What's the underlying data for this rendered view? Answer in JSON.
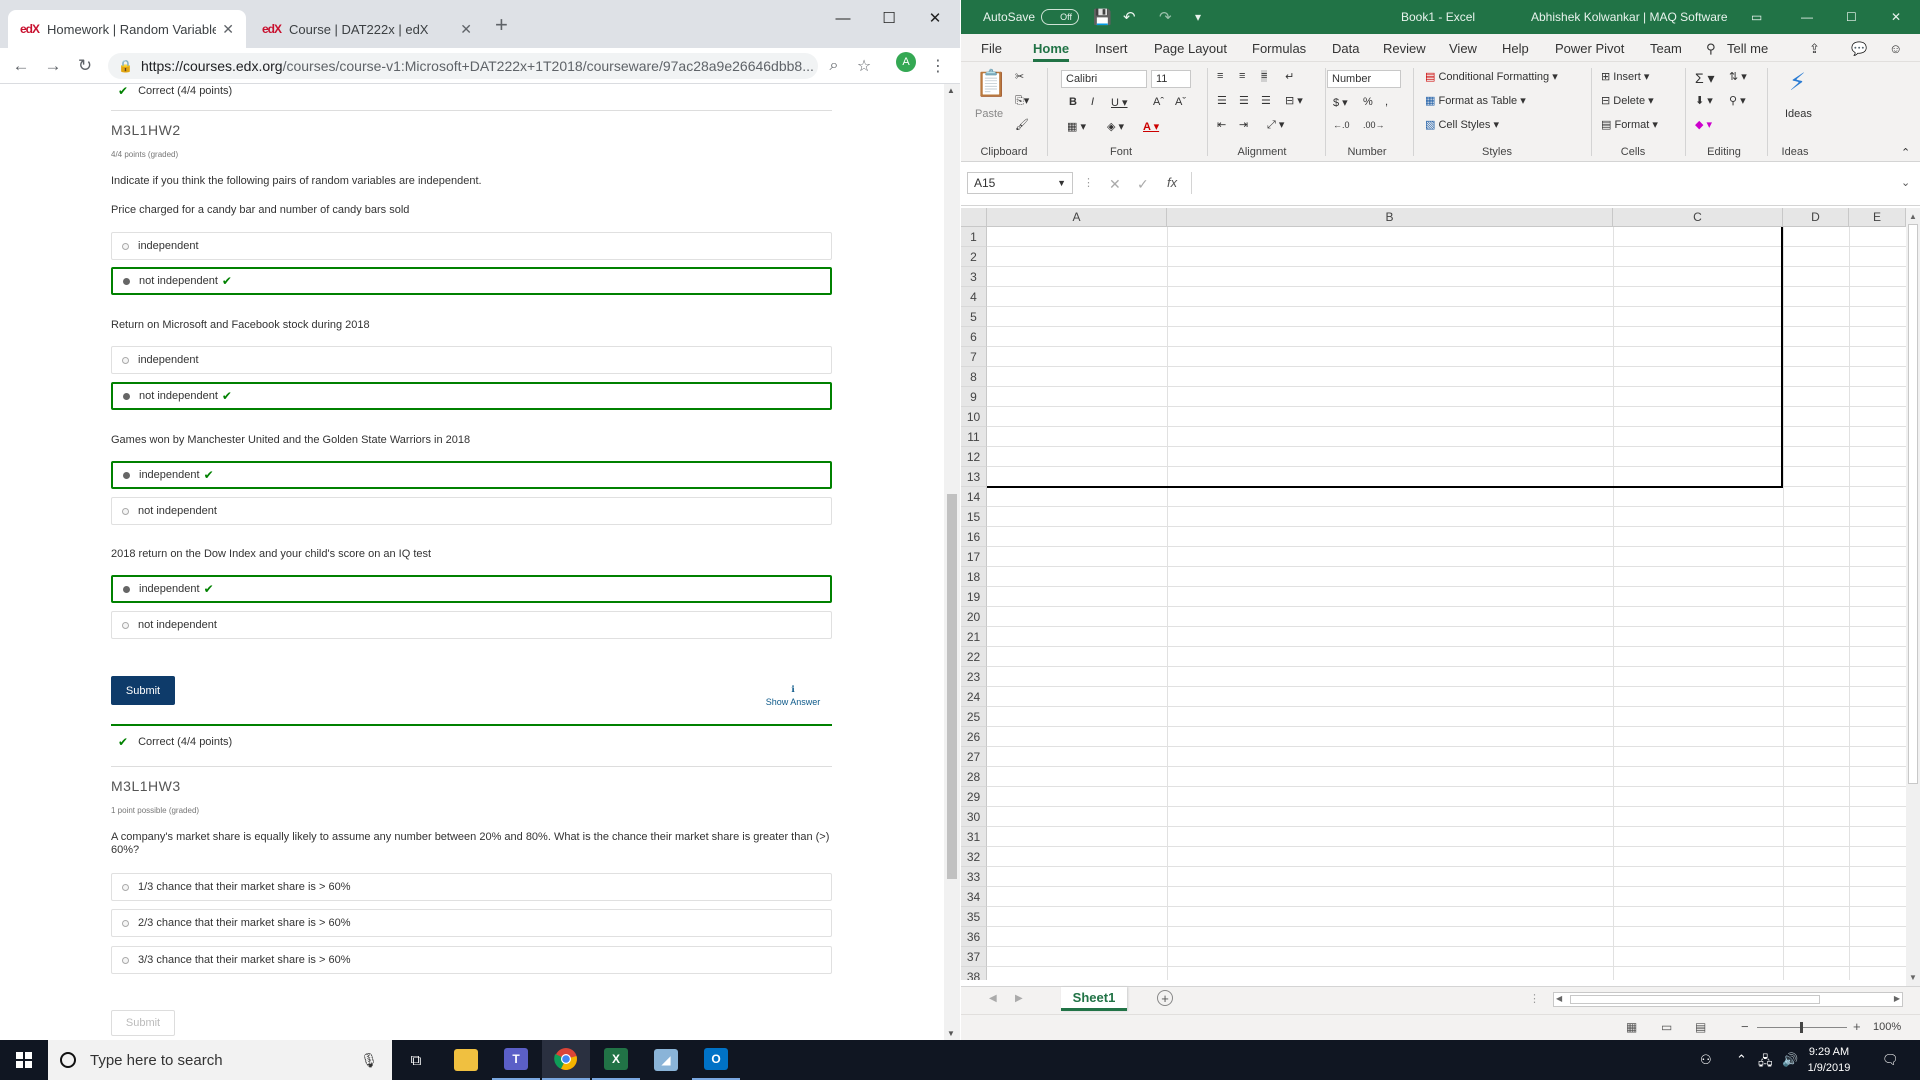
{
  "chrome": {
    "tabs": [
      {
        "favicon": "edX",
        "title": "Homework | Random Variable De"
      },
      {
        "favicon": "edX",
        "title": "Course | DAT222x | edX"
      }
    ],
    "new_tab": "+",
    "url_host": "https://courses.edx.org",
    "url_path": "/courses/course-v1:Microsoft+DAT222x+1T2018/courseware/97ac28a9e26646dbb8...",
    "avatar_letter": "A"
  },
  "edx": {
    "prev_correct": "Correct (4/4 points)",
    "hw2": {
      "title": "M3L1HW2",
      "subtitle": "4/4 points (graded)",
      "prompt": "Indicate if you think the following pairs of random variables are independent.",
      "questions": [
        {
          "text": "Price charged for a candy bar and number of candy bars sold",
          "options": [
            {
              "label": "independent"
            },
            {
              "label": "not independent"
            }
          ]
        },
        {
          "text": "Return on Microsoft and Facebook stock during 2018",
          "options": [
            {
              "label": "independent"
            },
            {
              "label": "not independent"
            }
          ]
        },
        {
          "text": "Games won by Manchester United and the Golden State Warriors in 2018",
          "options": [
            {
              "label": "independent"
            },
            {
              "label": "not independent"
            }
          ]
        },
        {
          "text": "2018 return on the Dow Index and your child's score on an IQ test",
          "options": [
            {
              "label": "independent"
            },
            {
              "label": "not independent"
            }
          ]
        }
      ],
      "submit": "Submit",
      "show_answer": "Show Answer",
      "result": "Correct (4/4 points)"
    },
    "hw3": {
      "title": "M3L1HW3",
      "subtitle": "1 point possible (graded)",
      "prompt": "A company's market share is equally likely to assume any number between 20% and 80%. What is the chance their market share is greater than (>) 60%?",
      "options": [
        "1/3 chance that their market share is > 60%",
        "2/3 chance that their market share is > 60%",
        "3/3 chance that their market share is > 60%"
      ],
      "submit": "Submit"
    }
  },
  "excel": {
    "autosave": "AutoSave",
    "autosave_state": "Off",
    "title": "Book1 - Excel",
    "user": "Abhishek Kolwankar | MAQ Software",
    "tabs": [
      "File",
      "Home",
      "Insert",
      "Page Layout",
      "Formulas",
      "Data",
      "Review",
      "View",
      "Help",
      "Power Pivot",
      "Team",
      "Tell me"
    ],
    "ribbon": {
      "paste": "Paste",
      "font_name": "Calibri",
      "font_size": "11",
      "number_format": "Number",
      "conditional_formatting": "Conditional Formatting",
      "format_as_table": "Format as Table",
      "cell_styles": "Cell Styles",
      "insert": "Insert",
      "delete": "Delete",
      "format": "Format",
      "ideas": "Ideas",
      "groups": [
        "Clipboard",
        "Font",
        "Alignment",
        "Number",
        "Styles",
        "Cells",
        "Editing",
        "Ideas"
      ]
    },
    "name_box": "A15",
    "fx": "fx",
    "columns": [
      "A",
      "B",
      "C",
      "D",
      "E"
    ],
    "rows": [
      "1",
      "2",
      "3",
      "4",
      "5",
      "6",
      "7",
      "8",
      "9",
      "10",
      "11",
      "12",
      "13",
      "14",
      "15",
      "16",
      "17",
      "18",
      "19",
      "20",
      "21",
      "22",
      "23",
      "24",
      "25",
      "26",
      "27",
      "28",
      "29",
      "30",
      "31",
      "32",
      "33",
      "34",
      "35",
      "36",
      "37",
      "38"
    ],
    "sheet_name": "Sheet1",
    "zoom": "100%"
  },
  "taskbar": {
    "search_placeholder": "Type here to search",
    "time": "9:29 AM",
    "date": "1/9/2019"
  }
}
